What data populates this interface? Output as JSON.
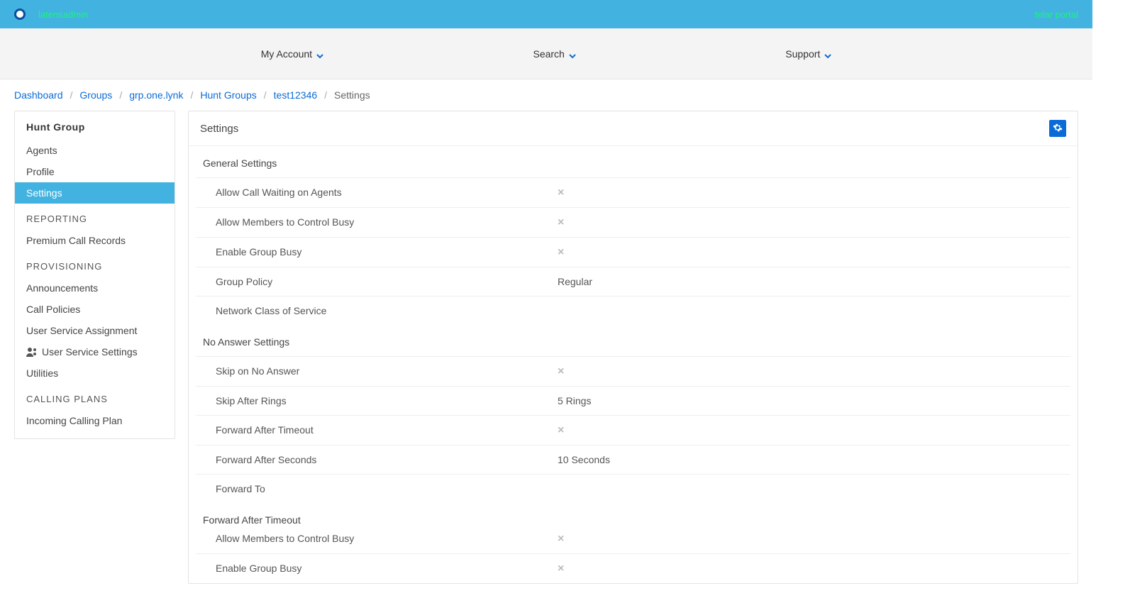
{
  "topbar": {
    "brand": "latensadmin",
    "portal": "telar portal"
  },
  "secnav": {
    "my_account": "My Account",
    "search": "Search",
    "support": "Support"
  },
  "crumbs": {
    "dashboard": "Dashboard",
    "groups": "Groups",
    "group": "grp.one.lynk",
    "huntgroups": "Hunt Groups",
    "hg": "test12346",
    "current": "Settings"
  },
  "sidebar": {
    "title": "Hunt Group",
    "items": {
      "agents": "Agents",
      "profile": "Profile",
      "settings": "Settings"
    },
    "reporting": {
      "title": "REPORTING",
      "premium": "Premium Call Records"
    },
    "provisioning": {
      "title": "PROVISIONING",
      "announcements": "Announcements",
      "call_policies": "Call Policies",
      "usa": "User Service Assignment",
      "uss": "User Service Settings",
      "utilities": "Utilities"
    },
    "calling_plans": {
      "title": "CALLING PLANS",
      "incoming": "Incoming Calling Plan"
    }
  },
  "panel": {
    "title": "Settings",
    "general": {
      "title": "General Settings",
      "allow_call_waiting": "Allow Call Waiting on Agents",
      "allow_members_busy": "Allow Members to Control Busy",
      "enable_group_busy": "Enable Group Busy",
      "group_policy": "Group Policy",
      "group_policy_val": "Regular",
      "ncos": "Network Class of Service"
    },
    "no_answer": {
      "title": "No Answer Settings",
      "skip_no_answer": "Skip on No Answer",
      "skip_after_rings": "Skip After Rings",
      "skip_after_rings_val": "5 Rings",
      "fwd_after_timeout": "Forward After Timeout",
      "fwd_after_seconds": "Forward After Seconds",
      "fwd_after_seconds_val": "10 Seconds",
      "fwd_to": "Forward To"
    },
    "fat": {
      "title": "Forward After Timeout",
      "allow_members_busy": "Allow Members to Control Busy",
      "enable_group_busy": "Enable Group Busy"
    }
  }
}
